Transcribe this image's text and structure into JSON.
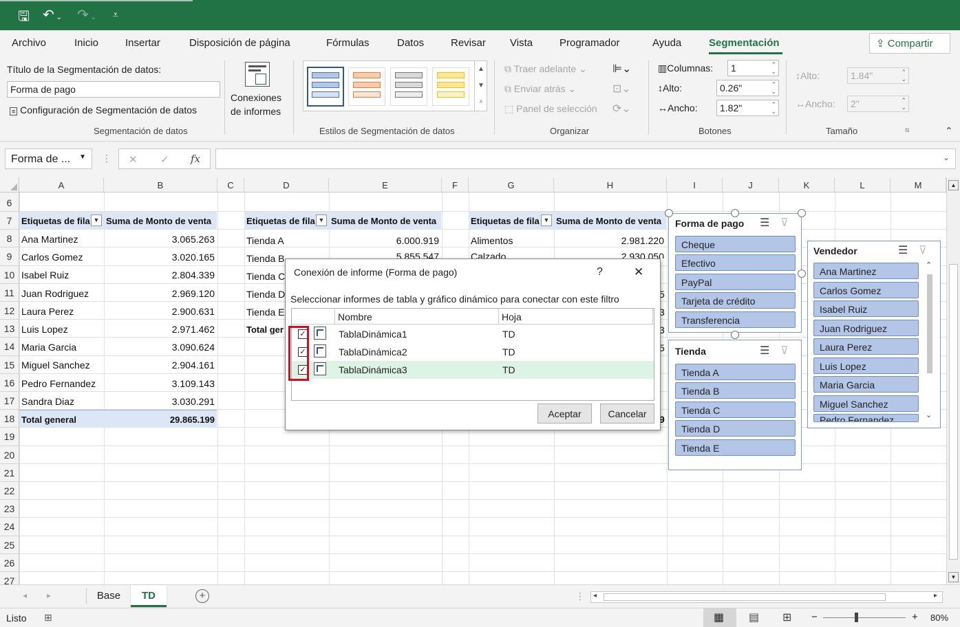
{
  "titlebar": {
    "save_icon": "save-icon",
    "undo_icon": "undo-icon",
    "redo_icon": "redo-icon",
    "customize_icon": "customize-qat-icon"
  },
  "menu": {
    "items": [
      "Archivo",
      "Inicio",
      "Insertar",
      "Disposición de página",
      "Fórmulas",
      "Datos",
      "Revisar",
      "Vista",
      "Programador",
      "Ayuda",
      "Segmentación"
    ],
    "active": "Segmentación",
    "share": "Compartir"
  },
  "ribbon": {
    "slicer_group": {
      "caption_label": "Título de la Segmentación de datos:",
      "caption_value": "Forma de pago",
      "settings": "Configuración de Segmentación de datos",
      "name": "Segmentación de datos"
    },
    "connections": {
      "line1": "Conexiones",
      "line2": "de informes"
    },
    "styles": {
      "name": "Estilos de Segmentación de datos"
    },
    "arrange": {
      "bring_forward": "Traer adelante",
      "send_backward": "Enviar atrás",
      "selection_pane": "Panel de selección",
      "name": "Organizar"
    },
    "buttons": {
      "columns_label": "Columnas:",
      "columns_value": "1",
      "height_label": "Alto:",
      "height_value": "0.26\"",
      "width_label": "Ancho:",
      "width_value": "1.82\"",
      "name": "Botones"
    },
    "size": {
      "height_label": "Alto:",
      "height_value": "1.84\"",
      "width_label": "Ancho:",
      "width_value": "2\"",
      "name": "Tamaño"
    }
  },
  "formula": {
    "namebox": "Forma de ...",
    "cancel": "✕",
    "enter": "✓",
    "fx": "fx",
    "value": ""
  },
  "grid": {
    "columns": [
      "A",
      "B",
      "C",
      "D",
      "E",
      "F",
      "G",
      "H",
      "I",
      "J",
      "K",
      "L",
      "M"
    ],
    "rows": [
      "6",
      "7",
      "8",
      "9",
      "10",
      "11",
      "12",
      "13",
      "14",
      "15",
      "16",
      "17",
      "18",
      "19",
      "20",
      "21",
      "22",
      "23",
      "24",
      "25",
      "26",
      "27"
    ],
    "pivot1": {
      "row_label": "Etiquetas de fila",
      "sum_label": "Suma de Monto de venta",
      "rows": [
        [
          "Ana Martinez",
          "3.065.263"
        ],
        [
          "Carlos Gomez",
          "3.020.165"
        ],
        [
          "Isabel Ruiz",
          "2.804.339"
        ],
        [
          "Juan Rodriguez",
          "2.969.120"
        ],
        [
          "Laura Perez",
          "2.900.631"
        ],
        [
          "Luis Lopez",
          "2.971.462"
        ],
        [
          "Maria Garcia",
          "3.090.624"
        ],
        [
          "Miguel Sanchez",
          "2.904.161"
        ],
        [
          "Pedro Fernandez",
          "3.109.143"
        ],
        [
          "Sandra Diaz",
          "3.030.291"
        ]
      ],
      "total_label": "Total general",
      "total_value": "29.865.199"
    },
    "pivot2": {
      "row_label": "Etiquetas de fila",
      "sum_label": "Suma de Monto de venta",
      "first_row": [
        "Tienda A",
        "6.000.919"
      ],
      "row2": "Tienda B",
      "row3": "Tienda C",
      "row4": "Tienda D",
      "row5": "Tienda E",
      "total_label": "Total ger",
      "partial_value": "5.855.547"
    },
    "pivot3": {
      "row_label": "Etiquetas de fila",
      "sum_label": "Suma de Monto de venta",
      "first_row": [
        "Alimentos",
        "2.981.220"
      ],
      "row2": "Calzado",
      "partial_value": "2.930.050",
      "edge_digits": [
        "5",
        "3",
        "3",
        "5",
        "9"
      ]
    }
  },
  "slicers": {
    "forma": {
      "title": "Forma de pago",
      "items": [
        "Cheque",
        "Efectivo",
        "PayPal",
        "Tarjeta de crédito",
        "Transferencia"
      ]
    },
    "tienda": {
      "title": "Tienda",
      "items": [
        "Tienda A",
        "Tienda B",
        "Tienda C",
        "Tienda D",
        "Tienda E"
      ]
    },
    "vendedor": {
      "title": "Vendedor",
      "items": [
        "Ana Martinez",
        "Carlos Gomez",
        "Isabel Ruiz",
        "Juan Rodriguez",
        "Laura Perez",
        "Luis Lopez",
        "Maria Garcia",
        "Miguel Sanchez",
        "Pedro Fernandez"
      ]
    }
  },
  "dialog": {
    "title": "Conexión de informe (Forma de pago)",
    "help": "?",
    "close": "✕",
    "instruction": "Seleccionar informes de tabla y gráfico dinámico para conectar con este filtro",
    "col_name": "Nombre",
    "col_sheet": "Hoja",
    "rows": [
      {
        "name": "TablaDinámica1",
        "sheet": "TD",
        "checked": true
      },
      {
        "name": "TablaDinámica2",
        "sheet": "TD",
        "checked": true
      },
      {
        "name": "TablaDinámica3",
        "sheet": "TD",
        "checked": true
      }
    ],
    "ok": "Aceptar",
    "cancel": "Cancelar",
    "highlight_color": "#dcf3e6",
    "selection_box_color": "#d20f1e"
  },
  "sheets": {
    "tabs": [
      "Base",
      "TD"
    ],
    "active": "TD"
  },
  "status": {
    "text": "Listo",
    "zoom": "80%",
    "minus": "−",
    "plus": "+"
  },
  "colors": {
    "excel_green": "#217346",
    "pivot_header": "#dde6f4",
    "slicer_item": "#b4c6e7"
  }
}
